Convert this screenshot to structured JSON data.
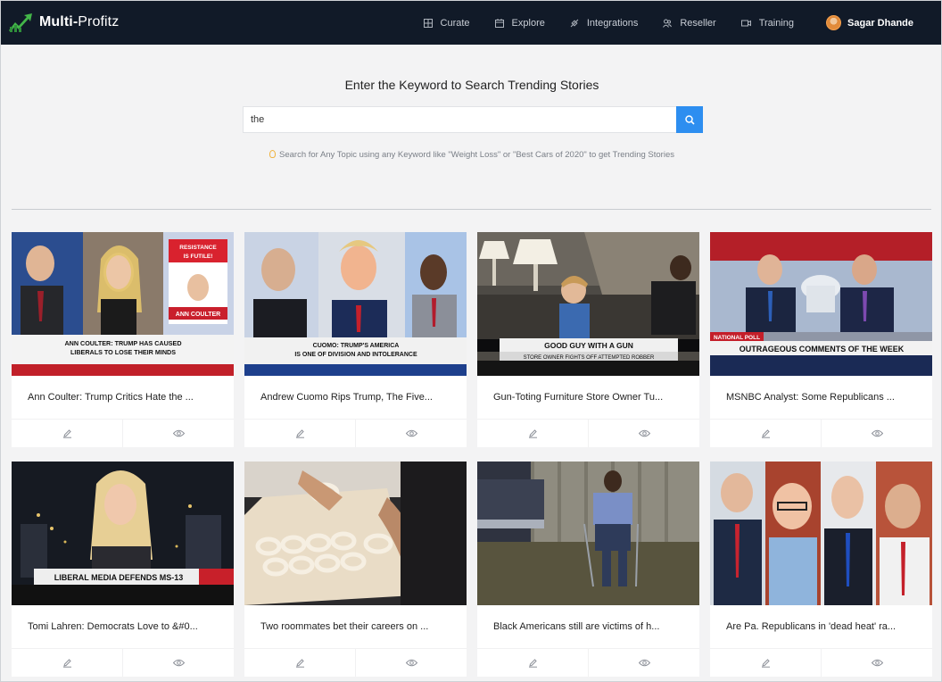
{
  "app": {
    "logo_bold": "Multi-",
    "logo_light": "Profitz"
  },
  "nav": {
    "items": [
      {
        "label": "Curate",
        "icon": "grid-icon"
      },
      {
        "label": "Explore",
        "icon": "calendar-icon"
      },
      {
        "label": "Integrations",
        "icon": "plug-icon"
      },
      {
        "label": "Reseller",
        "icon": "users-icon"
      },
      {
        "label": "Training",
        "icon": "video-icon"
      }
    ],
    "user_name": "Sagar Dhande"
  },
  "search": {
    "title": "Enter the Keyword to Search Trending Stories",
    "value": "the",
    "hint": "Search for Any Topic using any Keyword like \"Weight Loss\" or \"Best Cars of 2020\" to get Trending Stories"
  },
  "cards": [
    {
      "title": "Ann Coulter: Trump Critics Hate the ...",
      "caption": "ANN COULTER: TRUMP HAS CAUSED LIBERALS TO LOSE THEIR MINDS",
      "side_text": "RESISTANCE IS FUTILE!"
    },
    {
      "title": "Andrew Cuomo Rips Trump, The Five...",
      "caption": "CUOMO: TRUMP'S AMERICA IS ONE OF DIVISION AND INTOLERANCE"
    },
    {
      "title": "Gun-Toting Furniture Store Owner Tu...",
      "caption": "GOOD GUY WITH A GUN",
      "subcaption": "STORE OWNER FIGHTS OFF ATTEMPTED ROBBER"
    },
    {
      "title": "MSNBC Analyst: Some Republicans ...",
      "caption": "OUTRAGEOUS COMMENTS OF THE WEEK",
      "tag": "NATIONAL POLL"
    },
    {
      "title": "Tomi Lahren: Democrats Love to &#0...",
      "caption": "LIBERAL MEDIA DEFENDS MS-13"
    },
    {
      "title": "Two roommates bet their careers on ..."
    },
    {
      "title": "Black Americans still are victims of h..."
    },
    {
      "title": "Are Pa. Republicans in 'dead heat' ra..."
    }
  ],
  "colors": {
    "navbar": "#111a28",
    "accent": "#2d8ef0",
    "logo_green": "#43b649"
  }
}
